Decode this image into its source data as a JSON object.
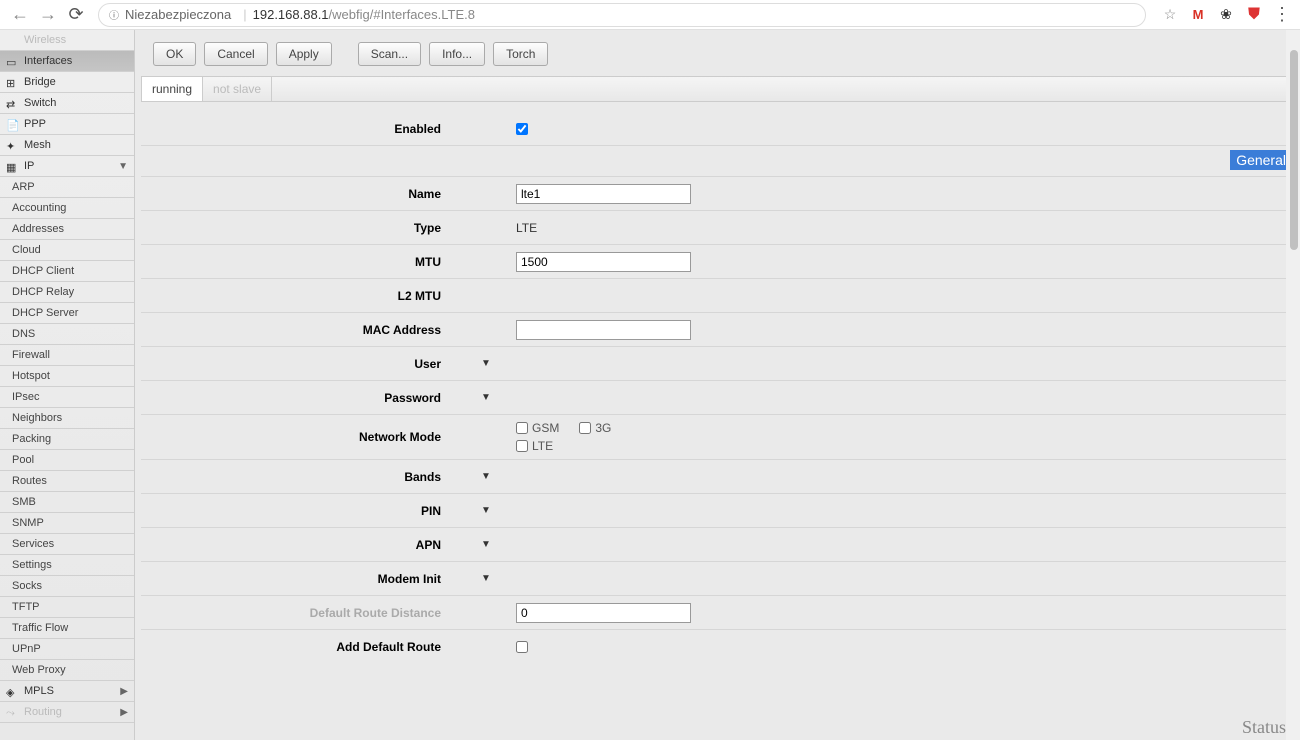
{
  "browser": {
    "security": "Niezabezpieczona",
    "host": "192.168.88.1",
    "path": "/webfig/#Interfaces.LTE.8"
  },
  "sidebar": {
    "items": [
      {
        "label": "Wireless",
        "icon": "wireless",
        "dim": true
      },
      {
        "label": "Interfaces",
        "icon": "interfaces",
        "active": true
      },
      {
        "label": "Bridge",
        "icon": "bridge"
      },
      {
        "label": "Switch",
        "icon": "switch"
      },
      {
        "label": "PPP",
        "icon": "ppp"
      },
      {
        "label": "Mesh",
        "icon": "mesh"
      },
      {
        "label": "IP",
        "icon": "ip",
        "expand": "down"
      }
    ],
    "ip_sub": [
      "ARP",
      "Accounting",
      "Addresses",
      "Cloud",
      "DHCP Client",
      "DHCP Relay",
      "DHCP Server",
      "DNS",
      "Firewall",
      "Hotspot",
      "IPsec",
      "Neighbors",
      "Packing",
      "Pool",
      "Routes",
      "SMB",
      "SNMP",
      "Services",
      "Settings",
      "Socks",
      "TFTP",
      "Traffic Flow",
      "UPnP",
      "Web Proxy"
    ],
    "after": [
      {
        "label": "MPLS",
        "icon": "mpls",
        "expand": "right"
      },
      {
        "label": "Routing",
        "icon": "routing",
        "expand": "right",
        "dim": true
      }
    ]
  },
  "toolbar": {
    "ok": "OK",
    "cancel": "Cancel",
    "apply": "Apply",
    "scan": "Scan...",
    "info": "Info...",
    "torch": "Torch"
  },
  "status": {
    "running": "running",
    "not_slave": "not slave"
  },
  "section": {
    "general": "General"
  },
  "form": {
    "enabled": {
      "label": "Enabled",
      "checked": true
    },
    "name": {
      "label": "Name",
      "value": "lte1"
    },
    "type": {
      "label": "Type",
      "value": "LTE"
    },
    "mtu": {
      "label": "MTU",
      "value": "1500"
    },
    "l2mtu": {
      "label": "L2 MTU",
      "value": ""
    },
    "mac": {
      "label": "MAC Address",
      "value": ""
    },
    "user": {
      "label": "User"
    },
    "password": {
      "label": "Password"
    },
    "network_mode": {
      "label": "Network Mode",
      "opts": {
        "gsm": "GSM",
        "g3": "3G",
        "lte": "LTE"
      }
    },
    "bands": {
      "label": "Bands"
    },
    "pin": {
      "label": "PIN"
    },
    "apn": {
      "label": "APN"
    },
    "modem_init": {
      "label": "Modem Init"
    },
    "default_route_distance": {
      "label": "Default Route Distance",
      "value": "0",
      "disabled": true
    },
    "add_default_route": {
      "label": "Add Default Route",
      "checked": false
    }
  },
  "corner": {
    "status": "Status"
  }
}
